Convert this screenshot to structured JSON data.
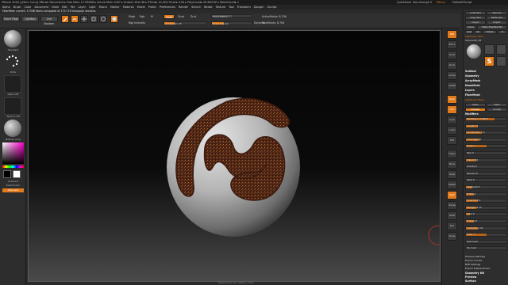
{
  "window": {
    "title": "ZBrush 2018 | [Marc Curry]  ZBrush Document  ▸ Free Mem 17.956GB ▸ Active Mem 1067 ▸ Scratch Disk 48 ▸ RTime▸ 10.424 Timer▸ 0.04 ▸ PolyCount▸ 50.664 KP ▸ MeshCount▸ 1",
    "quicksave": "QuickSave",
    "seethrough": "See-through 0",
    "menus_label": "Menus",
    "script": "DefaultZScript"
  },
  "menubar": [
    "Alpha",
    "Brush",
    "Color",
    "Document",
    "Draw",
    "Edit",
    "File",
    "Layer",
    "Light",
    "Macro",
    "Marker",
    "Material",
    "Movie",
    "Picker",
    "Preferences",
    "Render",
    "Stencil",
    "Stroke",
    "Texture",
    "Tool",
    "Transform",
    "Zplugin",
    "Zscript"
  ],
  "notice": "FiberMesh current: 17598 fibers composed of 175.776 triangular sections",
  "shelf": {
    "home_page": "Home Page",
    "lightbox": "LightBox",
    "live_boolean": "Live Boolean",
    "edit": "Edit",
    "draw": "Draw",
    "move": "Move",
    "scale": "Scale",
    "rotate": "Rotate",
    "mrgb": "Mrgb",
    "rgb": "Rgb",
    "m": "M",
    "zadd": "Zadd",
    "zsub": "Zsub",
    "zcut": "Zcut",
    "rgb_intensity": "Rgb Intensity",
    "z_intensity": "Z Intensity 25",
    "focal_shift": "Focal Shift 0",
    "draw_size": "Draw Size 64",
    "dynamic": "Dynamic",
    "active_points": "ActivePoints: 8,706",
    "total_points": "TotalPoints: 8,706"
  },
  "left_palette": {
    "brush_label": "Standard",
    "stroke_label": "Dots",
    "alpha_label": "Alpha Off",
    "texture_label": "Texture Off",
    "material_label": "MatCap Gray",
    "gradient_label": "Gradient",
    "switch_color": "SwitchColor",
    "alternate": "Alternate"
  },
  "right_toolbar": [
    "BPR",
    "SPix 3",
    "Scroll",
    "Zoom",
    "Actual",
    "AAHalf",
    "Persp",
    "Floor",
    "Local",
    "L.Sym",
    "XYZ",
    "Frame",
    "Move",
    "Scale",
    "Rotate",
    "PolyF",
    "Transp",
    "Ghost",
    "Solo",
    "Xpose"
  ],
  "tool_panel": {
    "load_tool": "Load Tool",
    "save_as": "Save As",
    "copy_tool": "Copy Tool",
    "paste_tool": "Paste Tool",
    "import": "Import",
    "export": "Export",
    "clone": "Clone",
    "make_polymesh": "Make PolyMesh3D",
    "goz": "GoZ",
    "all": "All",
    "visible": "Visible",
    "r": "R",
    "lightbox_tools": "Lightbox▸ Tools",
    "tool_name": "Sphere3D_48",
    "subtools_head": "Subtool",
    "sections": [
      "Geometry",
      "ArrayMesh",
      "NanoMesh",
      "Layers",
      "FiberMesh"
    ],
    "lightbox_fibers": "Lightbox▸ Fibers",
    "open": "Open",
    "save": "Save",
    "preview": "Preview",
    "accept": "Accept",
    "modifiers": "Modifiers",
    "sliders": [
      {
        "label": "MaxFibers 17.5833",
        "level": 0.7
      },
      {
        "label": "Length 15",
        "level": 0.3
      },
      {
        "label": "LevVariation 1.5",
        "level": 0.4
      },
      {
        "label": "Coverage 34",
        "level": 0.34
      },
      {
        "label": "Scale 1",
        "level": 0.5
      },
      {
        "label": "Slim 0",
        "level": 0.0
      },
      {
        "label": "Imbed 0.6",
        "level": 0.25
      },
      {
        "label": "Gravity 0",
        "level": 0.0
      },
      {
        "label": "Revolve 0",
        "level": 0.0
      },
      {
        "label": "Twist 0",
        "level": 0.0
      },
      {
        "label": "Segments 5",
        "level": 0.15
      },
      {
        "label": "Profile 4",
        "level": 0.2
      },
      {
        "label": "Scale Root 4",
        "level": 0.3
      },
      {
        "label": "BDiagonal 25",
        "level": 0.25
      },
      {
        "label": "Twist 5",
        "level": 0.1
      },
      {
        "label": "Clumps 6",
        "level": 0.2
      },
      {
        "label": "ClumpMore 30",
        "level": 0.3
      },
      {
        "label": "Color 1",
        "level": 0.5
      },
      {
        "label": "Root Color",
        "level": 0.0
      },
      {
        "label": "Tip Color",
        "level": 0.0
      }
    ],
    "bottom": [
      "Preview Settings",
      "Export Curves",
      "BPR Settings",
      "Export Displacement",
      "Geometry HD",
      "Preview",
      "Surface",
      "Deformation"
    ]
  },
  "canvas_caption": "Perspective 30, rotation, 30-3",
  "colors": {
    "accent": "#e07a1a",
    "fiber": "#5a2a18",
    "sphere": "#bdbdbd"
  },
  "icons": [
    "edit-icon",
    "draw-icon",
    "move-icon",
    "scale-icon",
    "rotate-icon"
  ]
}
